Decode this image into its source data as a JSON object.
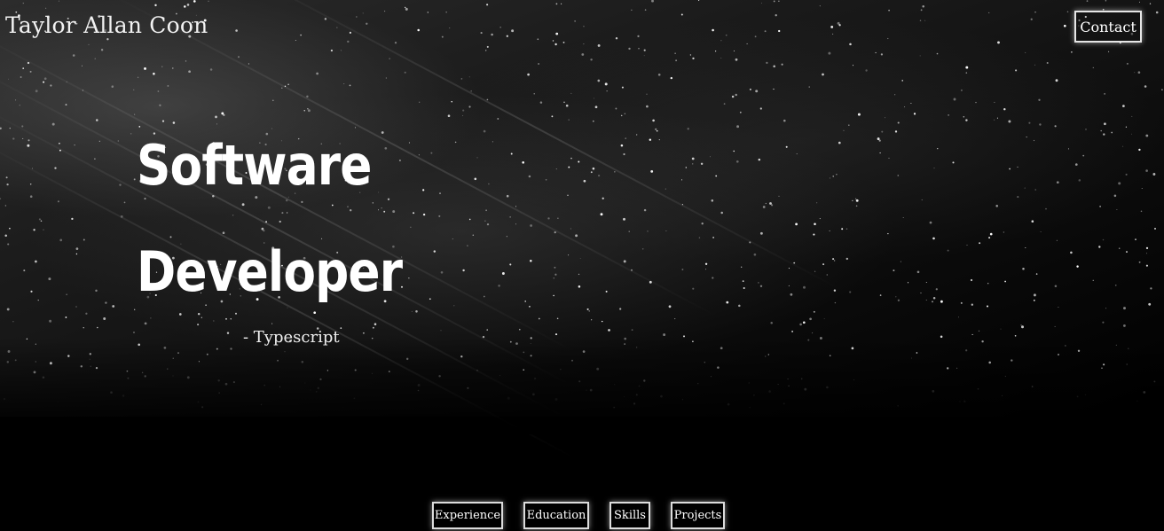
{
  "header": {
    "brand": "Taylor Allan Coon",
    "contact_label": "Contact"
  },
  "hero": {
    "headline_line1": "Software",
    "headline_line2": "Developer",
    "tagline": "- Typescript"
  },
  "nav": {
    "items": [
      {
        "label": "Experience"
      },
      {
        "label": "Education"
      },
      {
        "label": "Skills"
      },
      {
        "label": "Projects"
      }
    ]
  },
  "colors": {
    "background": "#000000",
    "text": "#f2f2f2",
    "button_border": "#e6e6e6"
  }
}
